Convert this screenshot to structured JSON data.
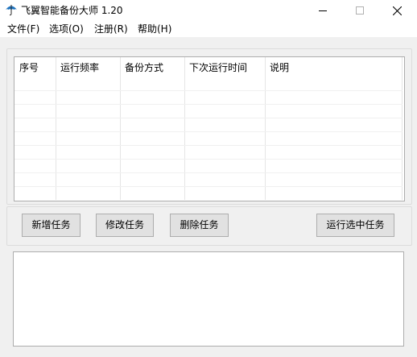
{
  "window": {
    "title": "飞翼智能备份大师 1.20",
    "app_icon": "umbrella-icon",
    "controls": [
      "minimize-icon",
      "maximize-icon",
      "close-icon"
    ]
  },
  "menu": [
    {
      "label": "文件(F)"
    },
    {
      "label": "选项(O)"
    },
    {
      "label": "注册(R)"
    },
    {
      "label": "帮助(H)"
    }
  ],
  "table": {
    "columns": [
      "序号",
      "运行频率",
      "备份方式",
      "下次运行时间",
      "说明"
    ],
    "rows": []
  },
  "buttons": {
    "add": "新增任务",
    "edit": "修改任务",
    "delete": "删除任务",
    "run_selected": "运行选中任务"
  },
  "log": {
    "text": ""
  },
  "colors": {
    "window_bg": "#f0f0f0",
    "button_bg": "#e1e1e1",
    "border": "#adadad",
    "icon_blue": "#1e73be"
  }
}
